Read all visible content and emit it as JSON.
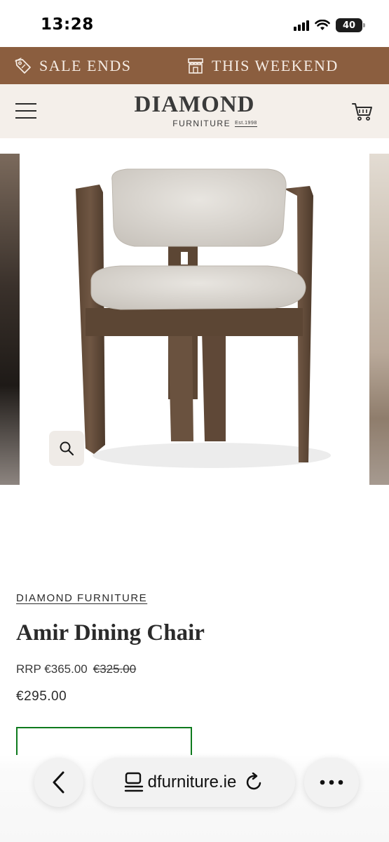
{
  "status_bar": {
    "time": "13:28",
    "battery": "40"
  },
  "promo": {
    "left_text": "SALE ENDS",
    "right_text": "THIS WEEKEND",
    "background": "#8b5e3f"
  },
  "header": {
    "logo_title": "DIAMOND",
    "logo_subtitle": "FURNITURE",
    "logo_est": "Est.1998"
  },
  "product": {
    "vendor": "DIAMOND FURNITURE",
    "title": "Amir Dining Chair",
    "rrp_label": "RRP €365.00",
    "compare_price": "€325.00",
    "sale_price": "€295.00"
  },
  "browser": {
    "url": "dfurniture.ie"
  },
  "colors": {
    "accent_green": "#0e7a1d",
    "header_bg": "#f4efea"
  }
}
